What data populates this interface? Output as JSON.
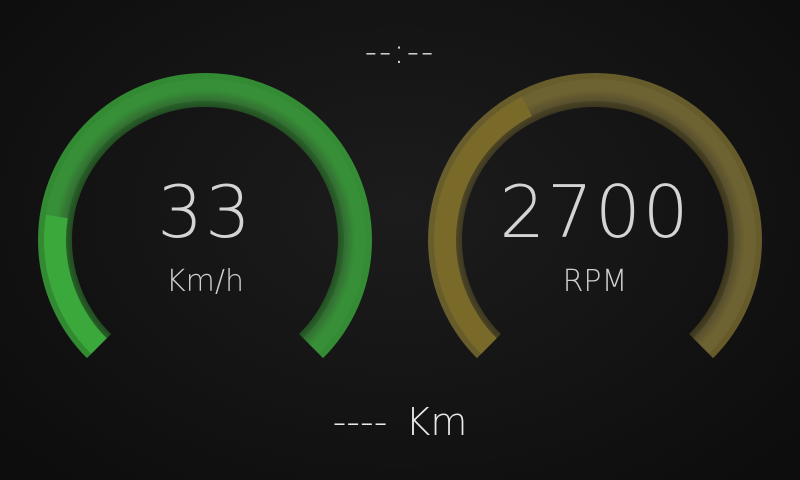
{
  "clock": {
    "time": "--:--"
  },
  "speed_gauge": {
    "value": "33",
    "unit": "Km/h",
    "fill_fraction": 0.2,
    "color": "#3aa83a"
  },
  "rpm_gauge": {
    "value": "2700",
    "unit": "RPM",
    "fill_fraction": 0.4,
    "color": "#7a6a2a"
  },
  "odometer": {
    "text": "---- Km"
  },
  "colors": {
    "background": "#141414",
    "track": "#2a2a2a",
    "text": "#d4d4d4"
  }
}
